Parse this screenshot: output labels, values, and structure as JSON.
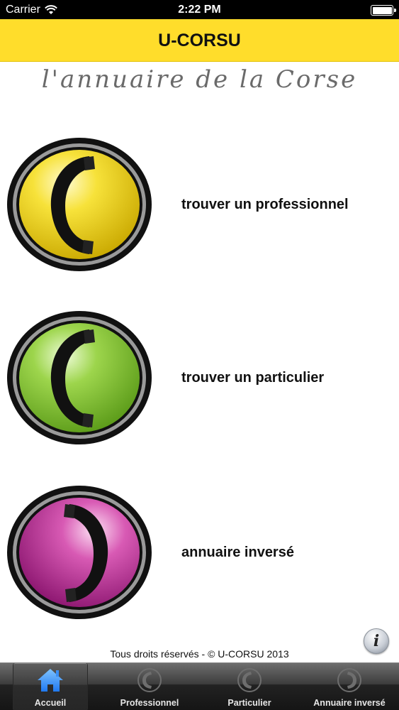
{
  "status_bar": {
    "carrier": "Carrier",
    "time": "2:22 PM"
  },
  "nav": {
    "title": "U-CORSU"
  },
  "subtitle": "l'annuaire de la Corse",
  "menu": [
    {
      "label": "trouver un professionnel",
      "color": "#f2d51c",
      "icon": "phone-yellow-icon"
    },
    {
      "label": "trouver un particulier",
      "color": "#8cc63f",
      "icon": "phone-green-icon"
    },
    {
      "label": "annuaire inversé",
      "color": "#c8359c",
      "icon": "phone-pink-icon"
    }
  ],
  "info_button": "i",
  "copyright": "Tous droits réservés - © U-CORSU 2013",
  "tabs": [
    {
      "label": "Accueil",
      "icon": "home-icon",
      "active": true
    },
    {
      "label": "Professionnel",
      "icon": "phone-icon",
      "active": false
    },
    {
      "label": "Particulier",
      "icon": "phone-icon",
      "active": false
    },
    {
      "label": "Annuaire inversé",
      "icon": "phone-icon",
      "active": false
    }
  ],
  "colors": {
    "accent": "#ffdd2b",
    "tab_active": "#2e8bff"
  }
}
